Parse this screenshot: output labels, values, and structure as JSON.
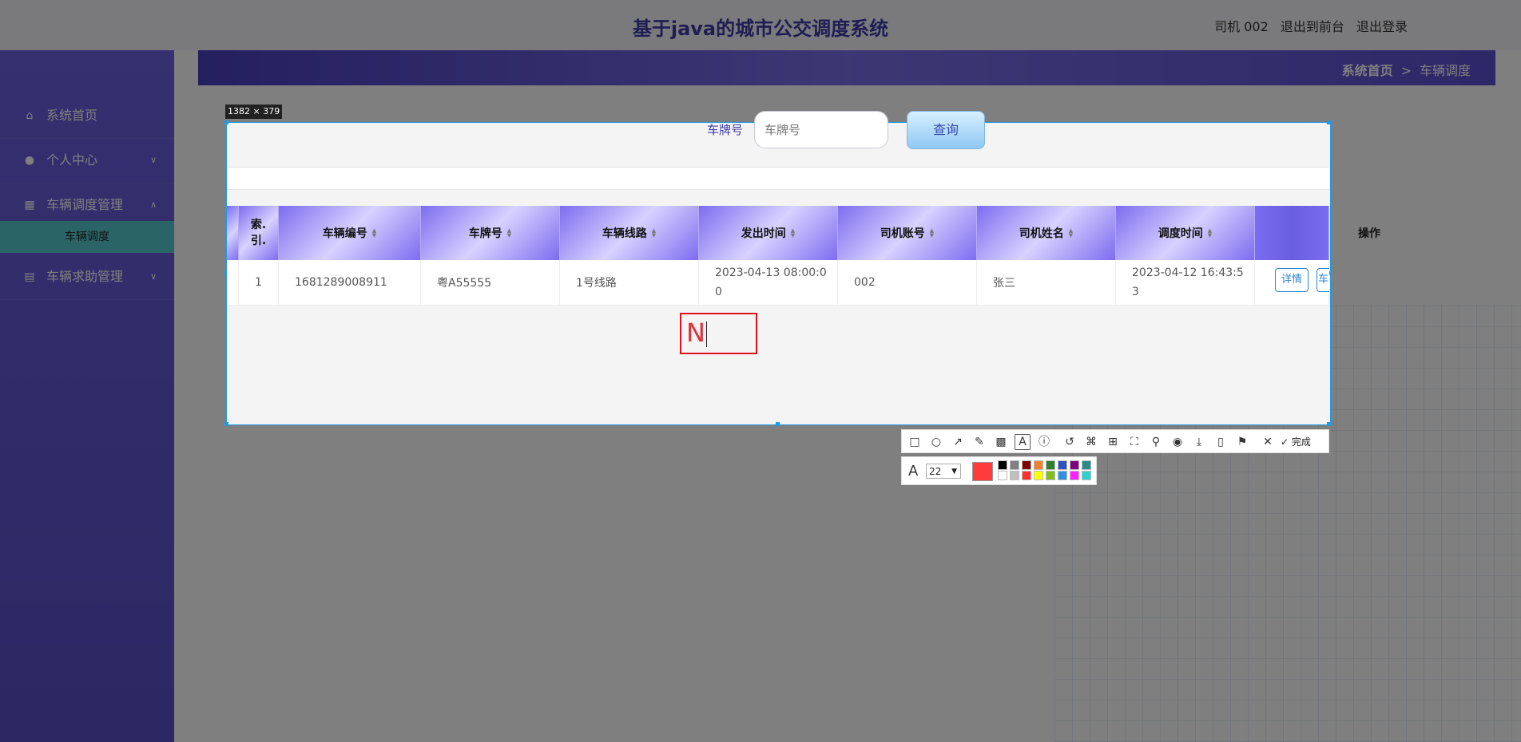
{
  "header": {
    "title": "基于java的城市公交调度系统",
    "user_label": "司机 002",
    "front_link": "退出到前台",
    "logout_link": "退出登录"
  },
  "sidebar": {
    "items": [
      {
        "label": "系统首页",
        "icon": "home-icon"
      },
      {
        "label": "个人中心",
        "icon": "user-icon"
      },
      {
        "label": "车辆调度管理",
        "icon": "grid-icon"
      },
      {
        "label": "车辆求助管理",
        "icon": "table-icon"
      }
    ],
    "subitems": [
      {
        "label": "车辆调度"
      }
    ]
  },
  "breadcrumb": {
    "home": "系统首页",
    "separator": ">",
    "current": "车辆调度"
  },
  "capture": {
    "size_label": "1382 × 379",
    "typed_text": "N"
  },
  "search": {
    "label": "车牌号",
    "placeholder": "车牌号",
    "button_label": "查询"
  },
  "table": {
    "headers": [
      "索引",
      "车辆编号",
      "车牌号",
      "车辆线路",
      "发出时间",
      "司机账号",
      "司机姓名",
      "调度时间",
      "操作"
    ],
    "index_header_lines": [
      "索.",
      "引."
    ],
    "rows": [
      {
        "index": "1",
        "vehicle_no": "1681289008911",
        "plate": "粤A55555",
        "route": "1号线路",
        "depart_time": "2023-04-13 08:00:00",
        "driver_account": "002",
        "driver_name": "张三",
        "dispatch_time": "2023-04-12 16:43:53"
      }
    ],
    "actions": [
      "详情",
      "车辆求助"
    ]
  },
  "toolbar": {
    "done_label": "完成",
    "tools": [
      "rectangle-icon",
      "ellipse-icon",
      "arrow-icon",
      "pencil-icon",
      "mosaic-icon",
      "text-icon",
      "serial-number-icon",
      "undo-icon",
      "translate-icon",
      "ocr-icon",
      "scroll-capture-icon",
      "pin-icon",
      "record-icon",
      "download-icon",
      "long-screenshot-icon",
      "bookmark-icon",
      "close-icon",
      "confirm-icon"
    ]
  },
  "text_options": {
    "font_size": "22",
    "current_color": "#ff3b3b",
    "palette": [
      "#000000",
      "#808080",
      "#800000",
      "#f08030",
      "#2f7f2f",
      "#3050c0",
      "#800080",
      "#2a8a8a",
      "#ffffff",
      "#c0c0c0",
      "#ff3030",
      "#ffff00",
      "#7fc020",
      "#3090e0",
      "#ff20ff",
      "#30d0d0"
    ]
  },
  "colors": {
    "accent": "#6c60e0",
    "title": "#3f3aa8",
    "capture_border": "#1e9be8"
  }
}
